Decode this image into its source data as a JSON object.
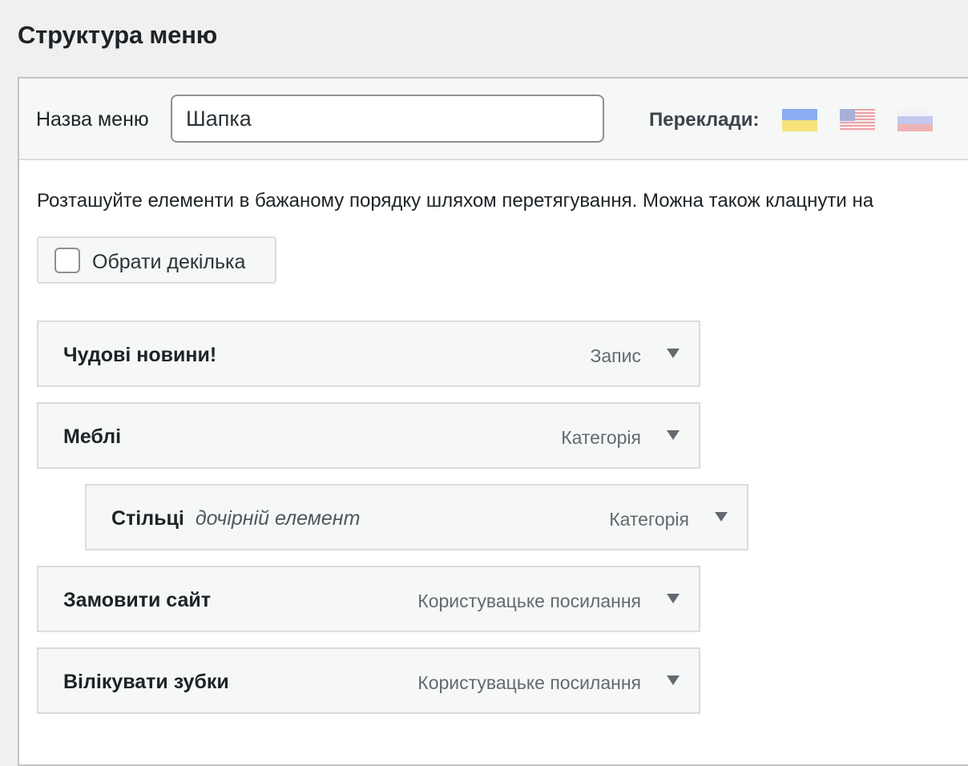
{
  "page": {
    "title": "Структура меню"
  },
  "header": {
    "name_label": "Назва меню",
    "name_value": "Шапка",
    "translations_label": "Переклади:",
    "flags": [
      "ukraine-flag-icon",
      "usa-flag-icon",
      "russia-flag-icon"
    ]
  },
  "instructions": "Розташуйте елементи в бажаному порядку шляхом перетягування. Можна також клацнути на",
  "bulk_select": {
    "label": "Обрати декілька",
    "checked": false
  },
  "menu_items": [
    {
      "title": "Чудові новини!",
      "subtitle": "",
      "type": "Запис",
      "depth": 0
    },
    {
      "title": "Меблі",
      "subtitle": "",
      "type": "Категорія",
      "depth": 0
    },
    {
      "title": "Стільці",
      "subtitle": "дочірній елемент",
      "type": "Категорія",
      "depth": 1
    },
    {
      "title": "Замовити сайт",
      "subtitle": "",
      "type": "Користувацьке посилання",
      "depth": 0
    },
    {
      "title": "Вілікувати зубки",
      "subtitle": "",
      "type": "Користувацьке посилання",
      "depth": 0
    }
  ],
  "colors": {
    "background": "#f0f0f1",
    "panel": "#ffffff",
    "item_bg": "#f6f7f7",
    "border": "#dcdcde",
    "muted_text": "#646970"
  }
}
